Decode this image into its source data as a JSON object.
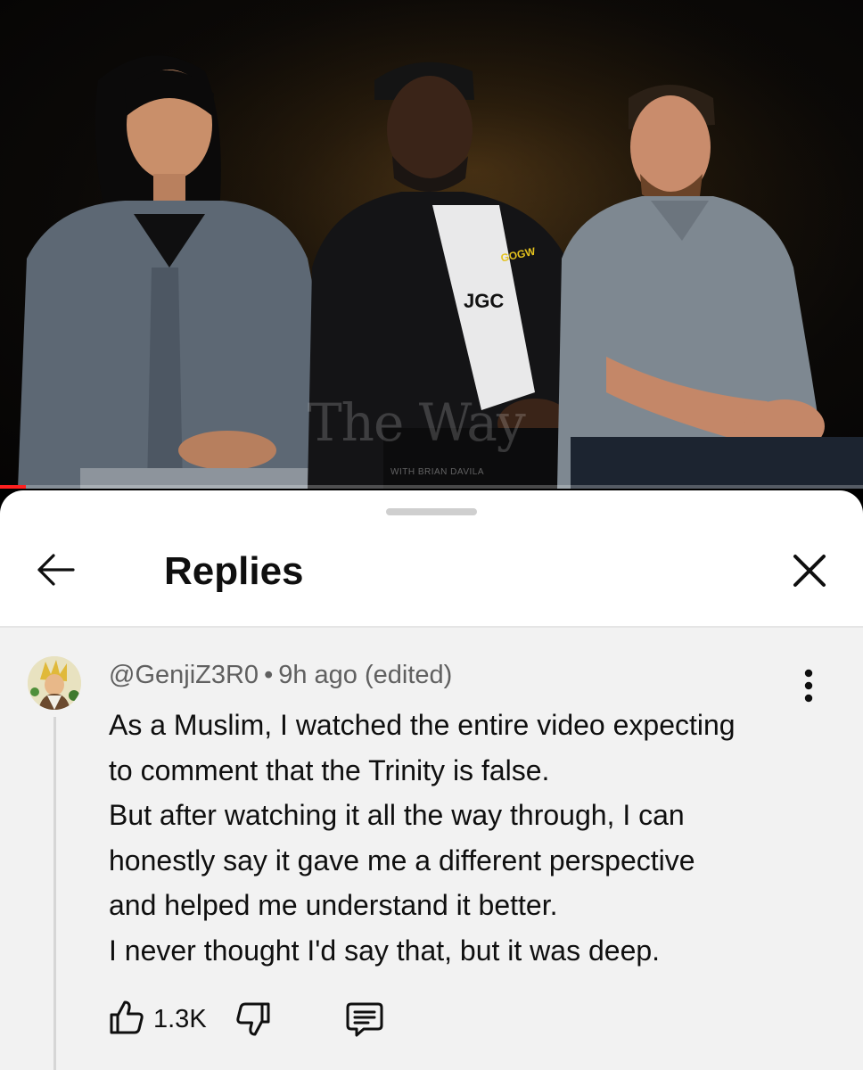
{
  "video": {
    "watermark_title": "The Way",
    "watermark_subtitle": "WITH BRIAN DAVILA",
    "shirt_text_1": "JGC",
    "shirt_text_2": "GOGW",
    "progress_fraction": 0.03,
    "progress_color": "#ff1f1f"
  },
  "sheet": {
    "title": "Replies",
    "back_icon": "arrow-left-icon",
    "close_icon": "close-icon"
  },
  "comment": {
    "author": "@GenjiZ3R0",
    "separator": "•",
    "time": "9h ago (edited)",
    "lines": [
      "As a Muslim, I watched the entire video expecting",
      "to comment that the Trinity is false.",
      "But after watching it all the way through, I can",
      "honestly say it gave me a different perspective",
      "and helped me understand it better.",
      "I never thought I'd say that, but it was deep."
    ],
    "like_count": "1.3K",
    "icons": {
      "like": "thumbs-up-icon",
      "dislike": "thumbs-down-icon",
      "reply": "comment-icon",
      "more": "more-vertical-icon"
    }
  },
  "colors": {
    "text_primary": "#0f0f0f",
    "text_secondary": "#606060",
    "sheet_background": "#ffffff",
    "comment_background": "#f2f2f2"
  }
}
